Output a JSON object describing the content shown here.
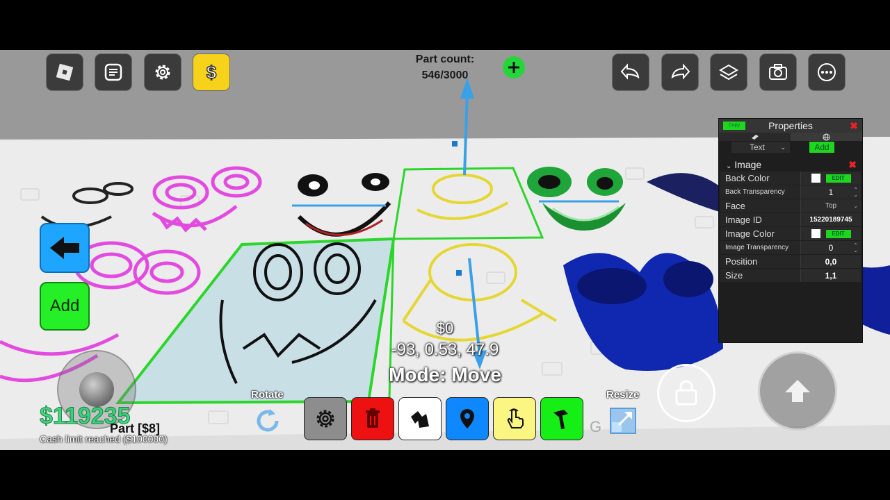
{
  "toolbar_left": [
    {
      "name": "roblox-menu-button",
      "icon": "roblox-logo-icon"
    },
    {
      "name": "chat-button",
      "icon": "chat-icon"
    },
    {
      "name": "settings-button",
      "icon": "gear-icon"
    },
    {
      "name": "shop-button",
      "icon": "dollar-icon"
    }
  ],
  "part_count": {
    "label": "Part count:",
    "value": "546/3000"
  },
  "toolbar_right": [
    {
      "name": "undo-button",
      "icon": "undo-arrow-icon"
    },
    {
      "name": "redo-button",
      "icon": "redo-arrow-icon"
    },
    {
      "name": "layers-button",
      "icon": "layers-icon"
    },
    {
      "name": "screenshot-button",
      "icon": "camera-icon"
    },
    {
      "name": "more-button",
      "icon": "more-icon"
    }
  ],
  "side": {
    "add_label": "Add"
  },
  "player": {
    "money": "$119235",
    "cash_limit": "Cash limit reached ($100000)",
    "part_label": "Part [$8]"
  },
  "center": {
    "price": "$0",
    "coords": "-93, 0.53, 47.9",
    "mode": "Mode: Move"
  },
  "tools": {
    "rotate_label": "Rotate",
    "resize_label": "Resize",
    "g_key": "G"
  },
  "properties": {
    "title": "Properties",
    "copy_label": "Copy",
    "text_select": "Text",
    "add_label": "Add",
    "section": "Image",
    "edit_label": "EDIT",
    "rows": [
      {
        "name": "Back Color",
        "value": "",
        "type": "color"
      },
      {
        "name": "Back Transparency",
        "value": "1",
        "type": "number"
      },
      {
        "name": "Face",
        "value": "Top",
        "type": "select"
      },
      {
        "name": "Image ID",
        "value": "15220189745",
        "type": "text"
      },
      {
        "name": "Image Color",
        "value": "",
        "type": "color"
      },
      {
        "name": "Image Transparency",
        "value": "0",
        "type": "number"
      },
      {
        "name": "Position",
        "value": "0,0",
        "type": "text"
      },
      {
        "name": "Size",
        "value": "1,1",
        "type": "text"
      }
    ]
  },
  "colors": {
    "accent_green": "#25ef27",
    "back_blue": "#1ea5ff",
    "money_green": "#1fd66b",
    "delete_red": "#ee1111",
    "place_blue": "#0f88ff",
    "select_yellow": "#fbf582"
  }
}
